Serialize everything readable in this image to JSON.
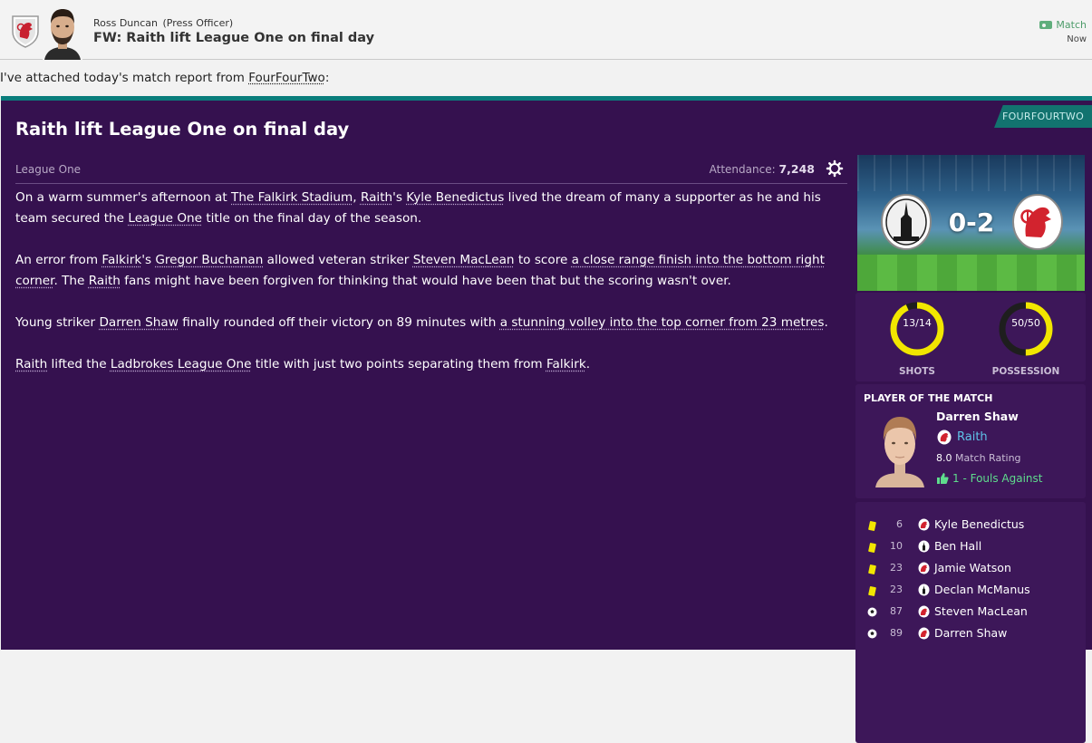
{
  "header": {
    "sender_name": "Ross Duncan",
    "sender_role": "(Press Officer)",
    "subject": "FW: Raith lift League One on final day",
    "tag": "Match",
    "time": "Now"
  },
  "intro": {
    "prefix": "I've attached today's match report from ",
    "source_link": "FourFourTwo",
    "suffix": ":"
  },
  "article": {
    "source_tag": "FOURFOURTWO",
    "title": "Raith lift League One on final day",
    "competition": "League One",
    "attendance_label": "Attendance:",
    "attendance_value": "7,248",
    "p1": {
      "t1": "On a warm summer's afternoon at ",
      "l1": "The Falkirk Stadium",
      "t2": ", ",
      "l2": "Raith",
      "t3": "'s ",
      "l3": "Kyle Benedictus",
      "t4": " lived the dream of many a supporter as he and his team secured the ",
      "l4": "League One",
      "t5": " title on the final day of the season."
    },
    "p2": {
      "t1": "An error from ",
      "l1": "Falkirk",
      "t2": "'s ",
      "l2": "Gregor Buchanan",
      "t3": " allowed veteran striker ",
      "l3": "Steven MacLean",
      "t4": " to score ",
      "l4": "a close range finish into the bottom right corner",
      "t5": ". The ",
      "l5": "Raith",
      "t6": " fans might have been forgiven for thinking that would have been that but the scoring wasn't over."
    },
    "p3": {
      "t1": "Young striker ",
      "l1": "Darren Shaw",
      "t2": " finally rounded off their victory on 89 minutes with ",
      "l2": "a stunning volley into the top corner from 23 metres",
      "t3": "."
    },
    "p4": {
      "l1": "Raith",
      "t1": " lifted the ",
      "l2": "Ladbrokes League One",
      "t2": " title with just two points separating them from ",
      "l3": "Falkirk",
      "t3": "."
    }
  },
  "match": {
    "score": "0-2",
    "home_badge": "falkirk-crest-icon",
    "away_badge": "raith-crest-icon"
  },
  "stats": {
    "shots_value": "13/14",
    "shots_label": "SHOTS",
    "shots_fill": 0.93,
    "possession_value": "50/50",
    "possession_label": "POSSESSION",
    "possession_fill": 0.5,
    "ring_color": "#f2e600"
  },
  "potm": {
    "heading": "PLAYER OF THE MATCH",
    "name": "Darren Shaw",
    "club": "Raith",
    "rating_value": "8.0",
    "rating_label": "Match Rating",
    "stat": "1 - Fouls Against"
  },
  "events": [
    {
      "type": "yellow-card-icon",
      "minute": "6",
      "club": "raith",
      "player": "Kyle Benedictus"
    },
    {
      "type": "yellow-card-icon",
      "minute": "10",
      "club": "falkirk",
      "player": "Ben Hall"
    },
    {
      "type": "yellow-card-icon",
      "minute": "23",
      "club": "raith",
      "player": "Jamie Watson"
    },
    {
      "type": "yellow-card-icon",
      "minute": "23",
      "club": "falkirk",
      "player": "Declan McManus"
    },
    {
      "type": "ball-icon",
      "minute": "87",
      "club": "raith",
      "player": "Steven MacLean"
    },
    {
      "type": "ball-icon",
      "minute": "89",
      "club": "raith",
      "player": "Darren Shaw"
    }
  ],
  "colors": {
    "article_bg": "#35114f",
    "panel_bg": "#3d1759",
    "accent_teal": "#0a7d7c",
    "link_blue": "#5fc3e8",
    "positive_green": "#5fdc8d"
  }
}
